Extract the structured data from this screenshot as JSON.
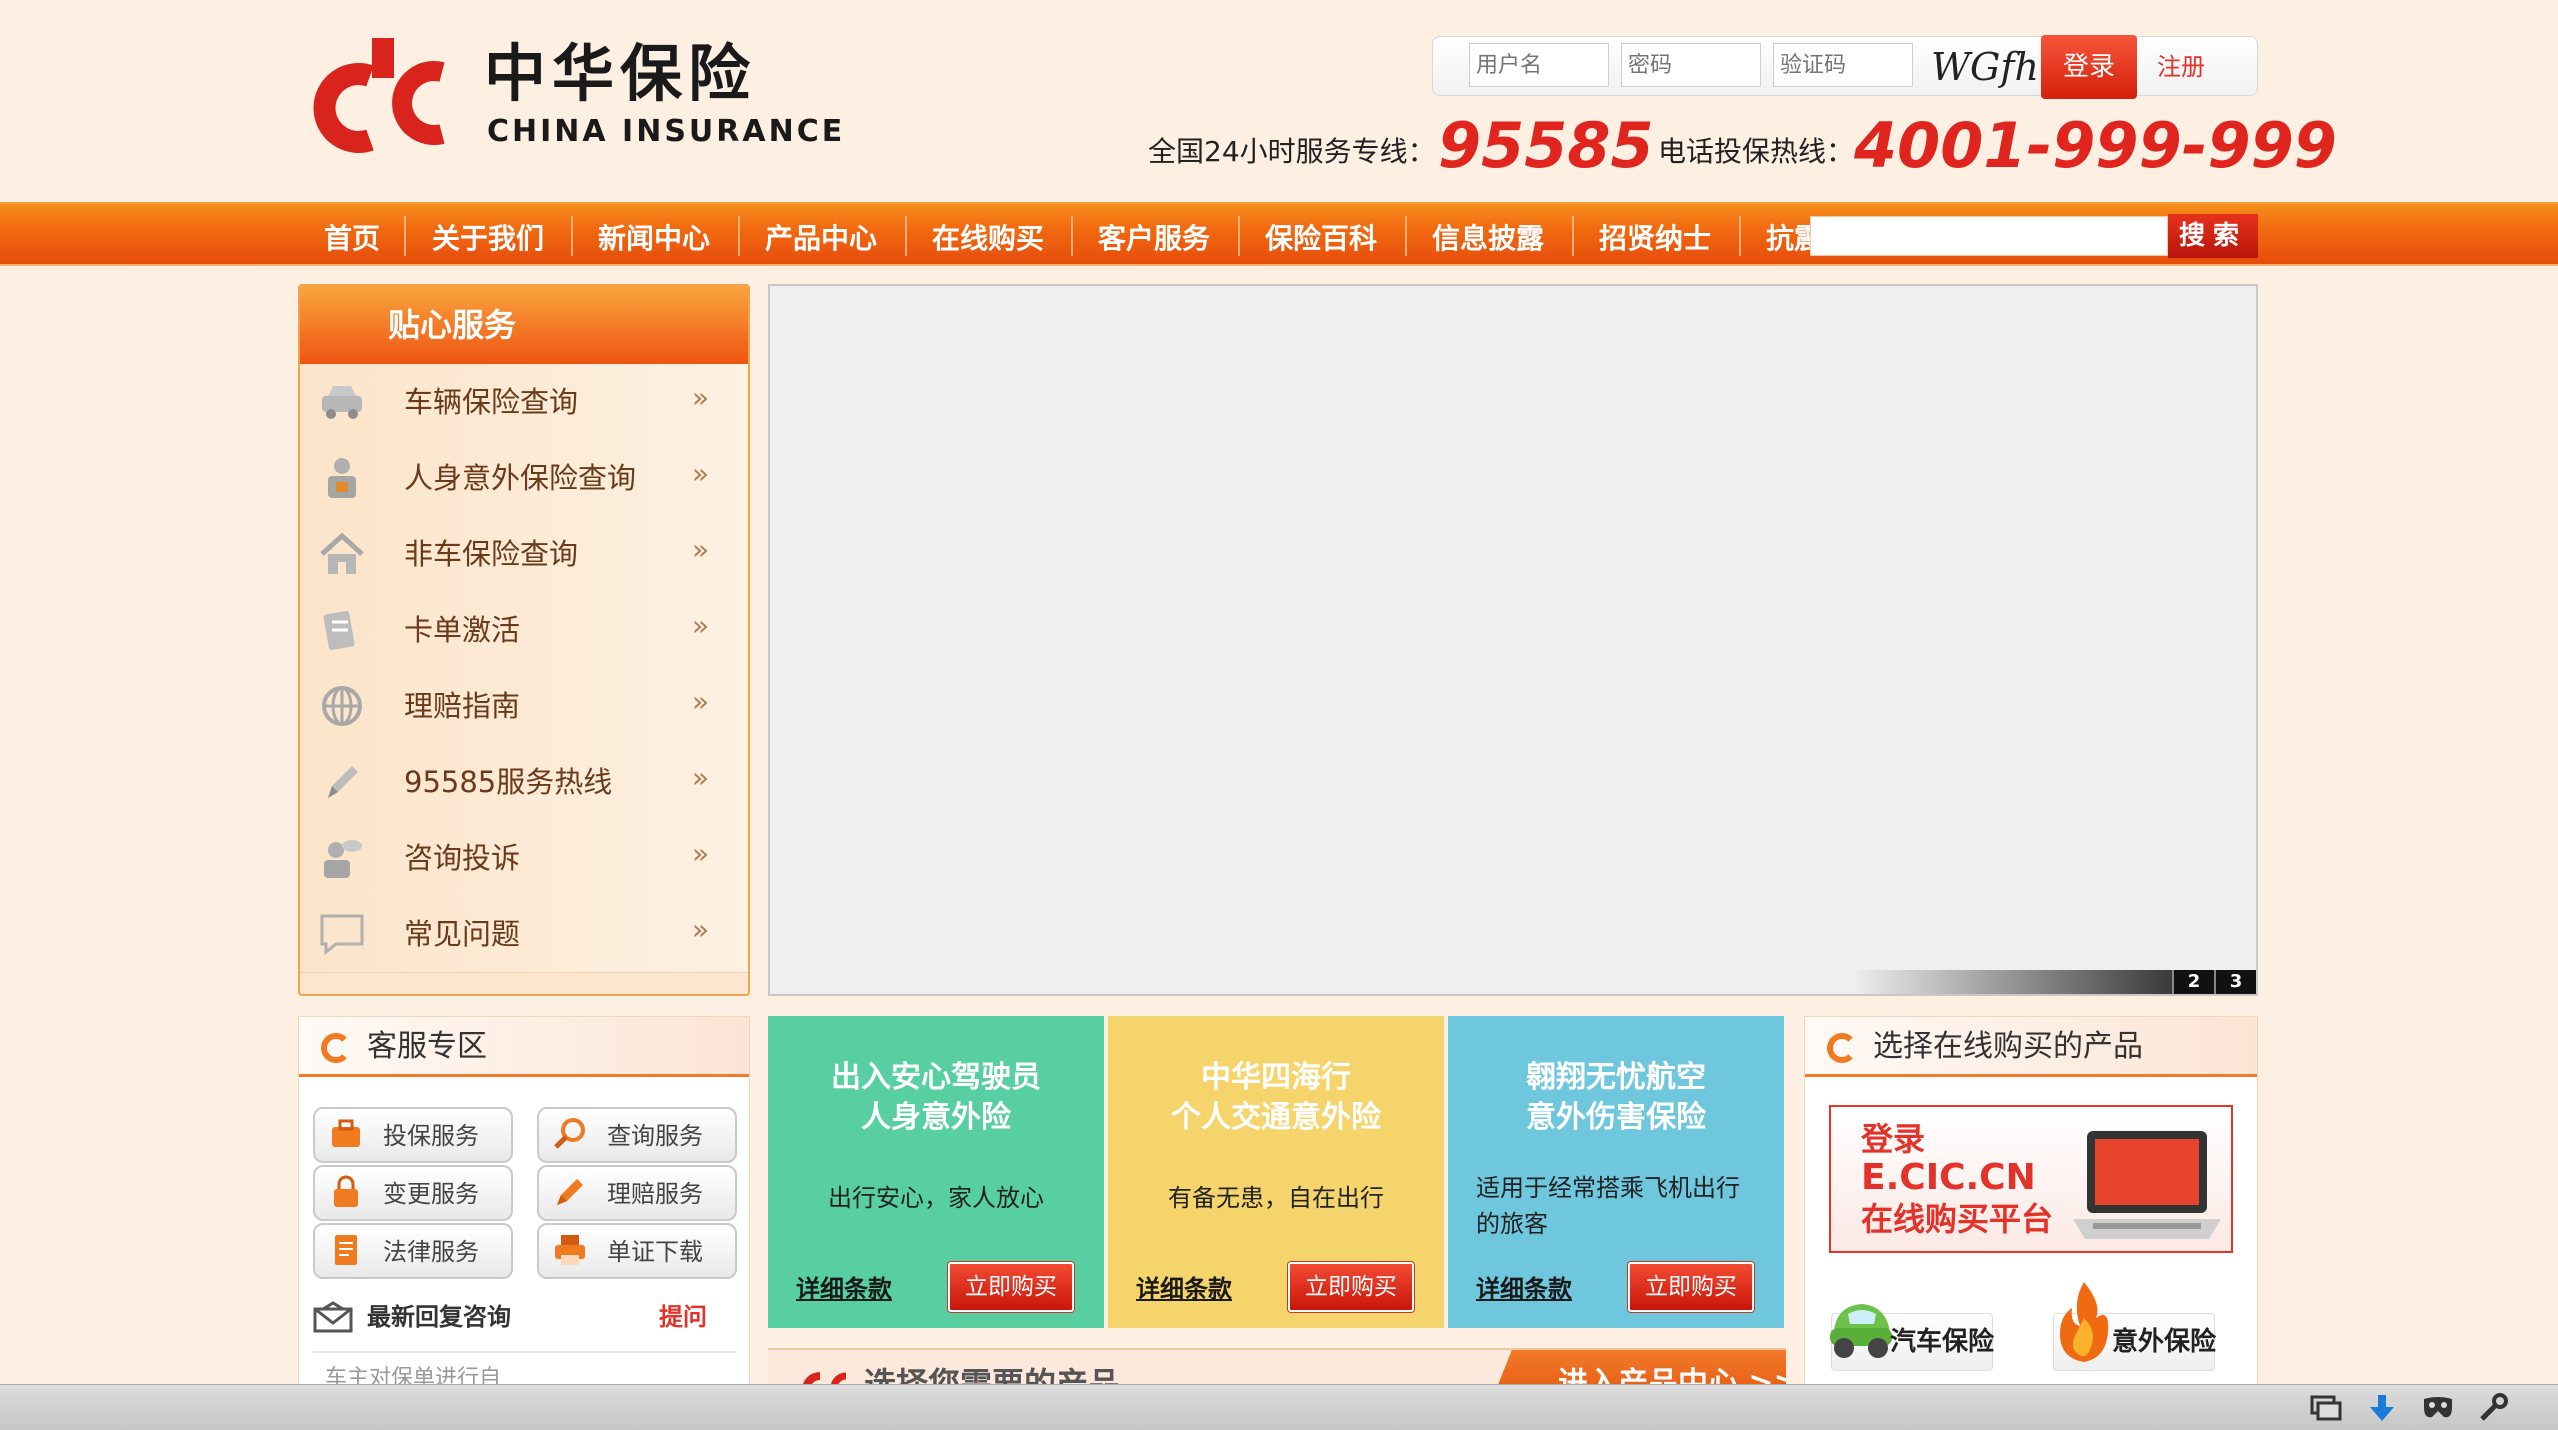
{
  "brand": {
    "name_cn": "中华保险",
    "name_en": "CHINA INSURANCE"
  },
  "login": {
    "username_placeholder": "用户名",
    "password_placeholder": "密码",
    "captcha_placeholder": "验证码",
    "captcha_text": "WGfhm",
    "login_label": "登录",
    "register_label": "注册"
  },
  "hotline": {
    "service_label": "全国24小时服务专线：",
    "service_number": "95585",
    "phone_label": "电话投保热线：",
    "phone_number": "4001-999-999"
  },
  "nav": {
    "items": [
      "首页",
      "关于我们",
      "新闻中心",
      "产品中心",
      "在线购买",
      "客户服务",
      "保险百科",
      "信息披露",
      "招贤纳士",
      "抗震"
    ],
    "search_label": "搜索"
  },
  "sidebar": {
    "title": "贴心服务",
    "arrow": "»",
    "items": [
      {
        "label": "车辆保险查询",
        "icon": "car-icon"
      },
      {
        "label": "人身意外保险查询",
        "icon": "person-icon"
      },
      {
        "label": "非车保险查询",
        "icon": "house-icon"
      },
      {
        "label": "卡单激活",
        "icon": "card-icon"
      },
      {
        "label": "理赔指南",
        "icon": "globe-icon"
      },
      {
        "label": "95585服务热线",
        "icon": "pen-icon"
      },
      {
        "label": "咨询投诉",
        "icon": "consult-icon"
      },
      {
        "label": "常见问题",
        "icon": "chat-bubble-icon"
      }
    ]
  },
  "banner": {
    "pages": [
      "2",
      "3"
    ]
  },
  "service_zone": {
    "title": "客服专区",
    "buttons": [
      "投保服务",
      "查询服务",
      "变更服务",
      "理赔服务",
      "法律服务",
      "单证下载"
    ],
    "reply_title": "最新回复咨询",
    "ask_label": "提问",
    "reply_item": "车主对保单进行自"
  },
  "cards": [
    {
      "title_1": "出入安心驾驶员",
      "title_2": "人身意外险",
      "desc": "出行安心，家人放心",
      "desc_2": "",
      "detail": "详细条款",
      "buy": "立即购买",
      "color": "#57cfa0"
    },
    {
      "title_1": "中华四海行",
      "title_2": "个人交通意外险",
      "desc": "有备无患，自在出行",
      "desc_2": "",
      "detail": "详细条款",
      "buy": "立即购买",
      "color": "#f6d46c"
    },
    {
      "title_1": "翱翔无忧航空",
      "title_2": "意外伤害保险",
      "desc": "适用于经常搭乘飞机出行",
      "desc_2": "的旅客",
      "detail": "详细条款",
      "buy": "立即购买",
      "color": "#6fc7dd"
    }
  ],
  "product_select": {
    "title": "选择您需要的产品",
    "enter": "进入产品中心 >>"
  },
  "online": {
    "title": "选择在线购买的产品",
    "ecic_line1": "登录",
    "ecic_line2": "E.CIC.CN",
    "ecic_line3": "在线购买平台",
    "car_label": "汽车保险",
    "accident_label": "意外保险"
  }
}
